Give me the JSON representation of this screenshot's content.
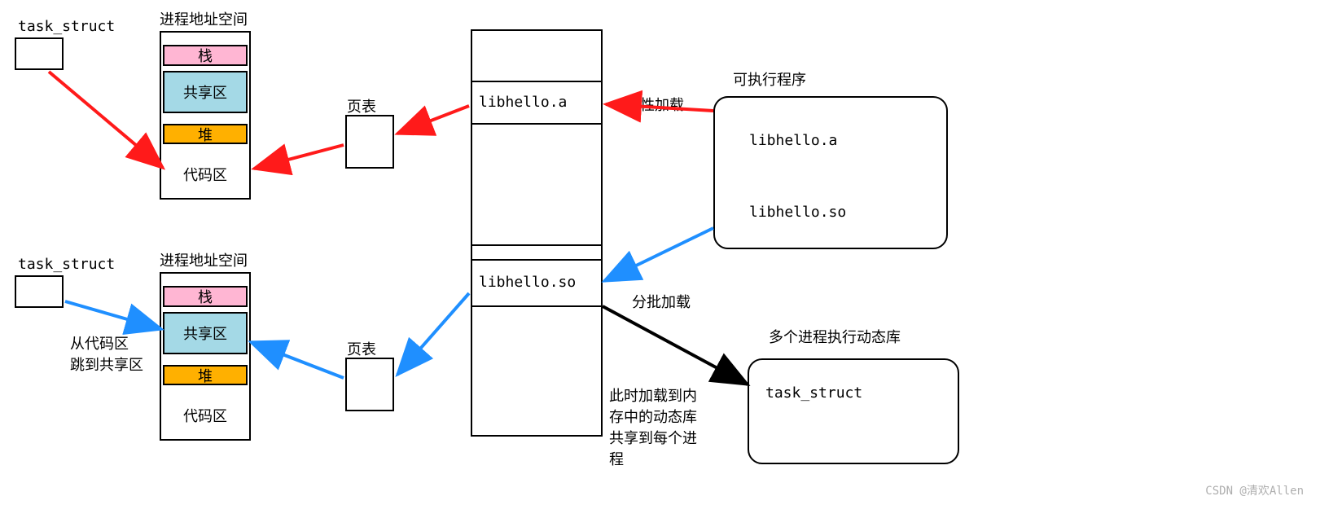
{
  "taskStruct1": "task_struct",
  "addrSpaceTitle": "进程地址空间",
  "segments": {
    "stack": "栈",
    "shared": "共享区",
    "heap": "堆",
    "code": "代码区"
  },
  "pageTable": "页表",
  "memory": {
    "libA": "libhello.a",
    "libSo": "libhello.so"
  },
  "loadOnce": "一次性加载",
  "loadBatch": "分批加载",
  "loadedNote": "此时加载到内\n存中的动态库\n共享到每个进\n程",
  "executable": {
    "title": "可执行程序",
    "libA": "libhello.a",
    "libSo": "libhello.so"
  },
  "dynProcTitle": "多个进程执行动态库",
  "dynProcInner": "task_struct",
  "taskStruct2": "task_struct",
  "codeToShared": "从代码区\n跳到共享区",
  "colors": {
    "stack": "#ffb6d3",
    "shared": "#a4d9e6",
    "heap": "#ffb000",
    "red": "#ff1a1a",
    "blue": "#1f8fff"
  },
  "attribution": "CSDN @清欢Allen"
}
